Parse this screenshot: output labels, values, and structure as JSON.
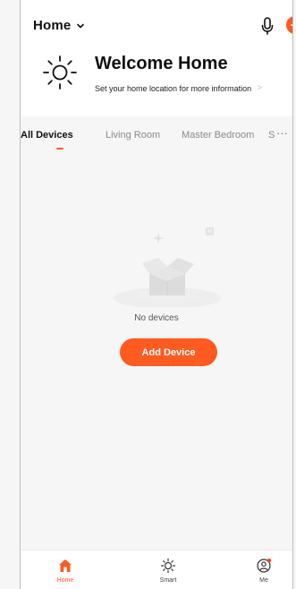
{
  "header": {
    "home_title": "Home"
  },
  "welcome": {
    "title": "Welcome Home",
    "subtitle": "Set your home location for more information",
    "arrow": ">"
  },
  "tabs": {
    "items": [
      {
        "label": "All Devices"
      },
      {
        "label": "Living Room"
      },
      {
        "label": "Master Bedroom"
      },
      {
        "label": "S"
      }
    ],
    "more": "···"
  },
  "empty_state": {
    "text": "No devices",
    "button_label": "Add Device"
  },
  "bottom_nav": {
    "items": [
      {
        "label": "Home"
      },
      {
        "label": "Smart"
      },
      {
        "label": "Me"
      }
    ]
  },
  "colors": {
    "accent": "#ff5a1f",
    "background": "#f6f6f6",
    "surface": "#ffffff"
  },
  "icons": {
    "dropdown": "chevron-down-icon",
    "microphone": "microphone-icon",
    "add": "plus-icon",
    "weather": "sun-icon",
    "empty": "empty-box-icon",
    "home": "home-icon",
    "smart": "smart-sun-icon",
    "me": "profile-icon"
  }
}
